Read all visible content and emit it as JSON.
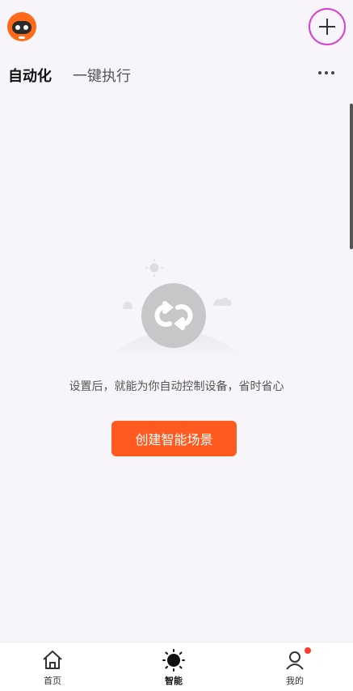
{
  "header": {
    "avatar_icon": "robot-avatar-icon",
    "add_icon": "plus-icon"
  },
  "tabs": [
    {
      "label": "自动化",
      "active": true
    },
    {
      "label": "一键执行",
      "active": false
    }
  ],
  "more_icon": "more-dots-icon",
  "empty_state": {
    "icon": "loop-sync-icon",
    "message": "设置后，就能为你自动控制设备，省时省心",
    "button_label": "创建智能场景"
  },
  "bottom_nav": [
    {
      "label": "首页",
      "icon": "home-icon"
    },
    {
      "label": "智能",
      "icon": "sun-icon"
    },
    {
      "label": "我的",
      "icon": "profile-icon"
    }
  ],
  "colors": {
    "accent": "#ff5a1f",
    "highlight_circle": "#d63fd0",
    "background": "#f7f5f9"
  }
}
